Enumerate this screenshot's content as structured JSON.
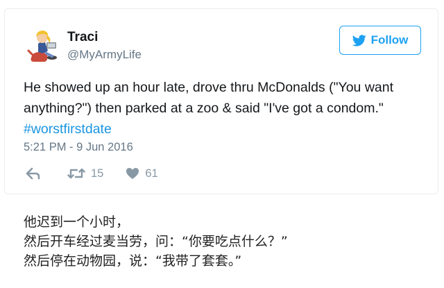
{
  "tweet": {
    "user": {
      "display_name": "Traci",
      "handle": "@MyArmyLife",
      "avatar_icon": "cartoon-character-avatar-icon"
    },
    "follow_button": {
      "label": "Follow",
      "icon": "bird-icon",
      "color": "#1da1f2"
    },
    "text_before_hashtag": "He showed up an hour late, drove thru McDonalds (\"You want anything?\") then parked at a zoo & said \"I've got a condom.\" ",
    "hashtag": "#worstfirstdate",
    "hashtag_color": "#1b95e0",
    "timestamp": "5:21 PM - 9 Jun 2016",
    "actions": {
      "reply_icon": "reply-icon",
      "retweet_icon": "retweet-icon",
      "retweet_count": "15",
      "like_icon": "heart-icon",
      "like_count": "61"
    }
  },
  "caption": {
    "lines": [
      "他迟到一个小时，",
      "然后开车经过麦当劳，问：“你要吃点什么？”",
      "然后停在动物园，说：“我带了套套。”"
    ]
  }
}
